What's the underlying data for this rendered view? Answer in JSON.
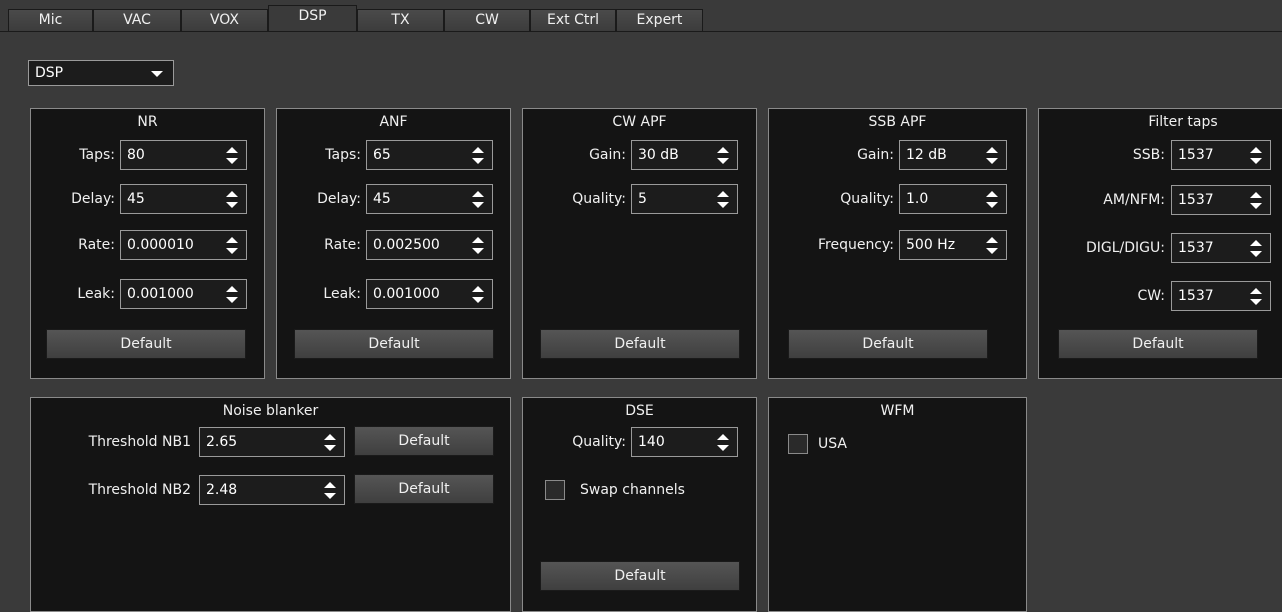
{
  "tabs": [
    {
      "label": "Mic"
    },
    {
      "label": "VAC"
    },
    {
      "label": "VOX"
    },
    {
      "label": "DSP",
      "active": true
    },
    {
      "label": "TX"
    },
    {
      "label": "CW"
    },
    {
      "label": "Ext Ctrl"
    },
    {
      "label": "Expert"
    }
  ],
  "selector": {
    "value": "DSP"
  },
  "nr": {
    "title": "NR",
    "taps_label": "Taps:",
    "taps": "80",
    "delay_label": "Delay:",
    "delay": "45",
    "rate_label": "Rate:",
    "rate": "0.000010",
    "leak_label": "Leak:",
    "leak": "0.001000",
    "default_label": "Default"
  },
  "anf": {
    "title": "ANF",
    "taps_label": "Taps:",
    "taps": "65",
    "delay_label": "Delay:",
    "delay": "45",
    "rate_label": "Rate:",
    "rate": "0.002500",
    "leak_label": "Leak:",
    "leak": "0.001000",
    "default_label": "Default"
  },
  "cw_apf": {
    "title": "CW APF",
    "gain_label": "Gain:",
    "gain": "30 dB",
    "quality_label": "Quality:",
    "quality": "5",
    "default_label": "Default"
  },
  "ssb_apf": {
    "title": "SSB APF",
    "gain_label": "Gain:",
    "gain": "12 dB",
    "quality_label": "Quality:",
    "quality": "1.0",
    "frequency_label": "Frequency:",
    "frequency": "500 Hz",
    "default_label": "Default"
  },
  "filter_taps": {
    "title": "Filter taps",
    "ssb_label": "SSB:",
    "ssb": "1537",
    "amnfm_label": "AM/NFM:",
    "amnfm": "1537",
    "digl_label": "DIGL/DIGU:",
    "digl": "1537",
    "cw_label": "CW:",
    "cw": "1537",
    "default_label": "Default"
  },
  "noise_blanker": {
    "title": "Noise blanker",
    "nb1_label": "Threshold NB1",
    "nb1": "2.65",
    "nb2_label": "Threshold NB2",
    "nb2": "2.48",
    "default1_label": "Default",
    "default2_label": "Default"
  },
  "dse": {
    "title": "DSE",
    "quality_label": "Quality:",
    "quality": "140",
    "swap_label": "Swap channels",
    "swap_checked": false,
    "default_label": "Default"
  },
  "wfm": {
    "title": "WFM",
    "usa_label": "USA",
    "usa_checked": false
  }
}
